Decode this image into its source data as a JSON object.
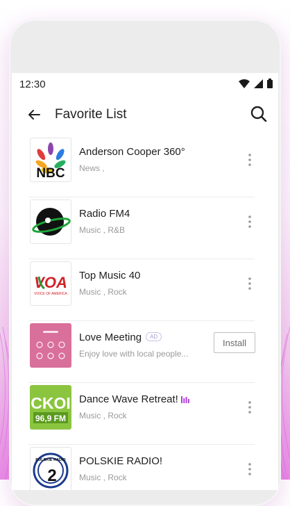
{
  "status": {
    "time": "12:30"
  },
  "header": {
    "title": "Favorite List"
  },
  "items": [
    {
      "title": "Anderson Cooper 360°",
      "subtitle": "News ,",
      "logo": "NBC"
    },
    {
      "title": "Radio FM4",
      "subtitle": "Music , R&B",
      "logo": "fm4-logo"
    },
    {
      "title": "Top Music 40",
      "subtitle": "Music , Rock",
      "logo": "VOA",
      "logo_caption": "VOICE OF AMERICA"
    },
    {
      "title": "Love Meeting",
      "subtitle": "Enjoy love with local people...",
      "badge": "AD",
      "action": "Install",
      "logo": "love-meeting-app-icon"
    },
    {
      "title": "Dance Wave Retreat!",
      "subtitle": "Music , Rock",
      "playing": true,
      "logo": "CKOI",
      "logo_caption": "96,9 FM"
    },
    {
      "title": "POLSKIE RADIO!",
      "subtitle": "Music , Rock",
      "logo": "POLSKIE RADIO",
      "logo_number": "2"
    }
  ],
  "colors": {
    "accent": "#b23fd8",
    "background_pink": "#e98be6"
  }
}
